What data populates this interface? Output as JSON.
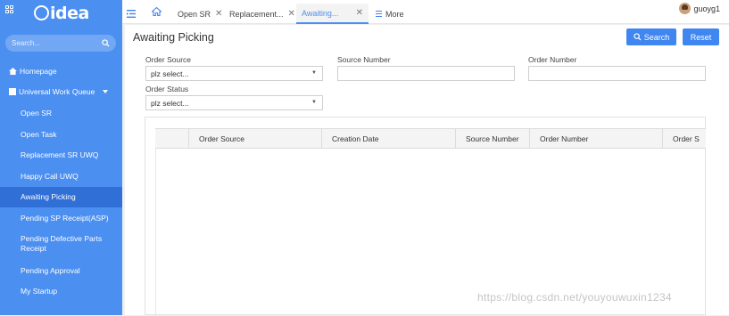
{
  "sidebar": {
    "logo_text": "idea",
    "search_placeholder": "Search...",
    "items": [
      {
        "label": "Homepage",
        "icon": "home-icon"
      },
      {
        "label": "Universal Work Queue",
        "icon": "square-icon"
      },
      {
        "label": "Open SR"
      },
      {
        "label": "Open Task"
      },
      {
        "label": "Replacement SR UWQ"
      },
      {
        "label": "Happy Call UWQ"
      },
      {
        "label": "Awaiting Picking",
        "active": true
      },
      {
        "label": "Pending SP Receipt(ASP)"
      },
      {
        "label": "Pending Defective Parts Receipt"
      },
      {
        "label": "Pending Approval"
      },
      {
        "label": "My Startup"
      }
    ]
  },
  "topbar": {
    "tabs": [
      {
        "label": "Open SR",
        "closable": true
      },
      {
        "label": "Replacement...",
        "closable": true
      },
      {
        "label": "Awaiting...",
        "closable": true,
        "active": true
      },
      {
        "label": "More",
        "icon": "list-icon"
      }
    ],
    "user": "guoyg1"
  },
  "main": {
    "title": "Awaiting Picking",
    "search_button": "Search",
    "reset_button": "Reset",
    "filters": {
      "order_source_label": "Order Source",
      "order_source_value": "plz select...",
      "source_number_label": "Source Number",
      "order_number_label": "Order Number",
      "order_status_label": "Order Status",
      "order_status_value": "plz select..."
    },
    "grid_columns": [
      "",
      "Order Source",
      "Creation Date",
      "Source Number",
      "Order Number",
      "Order S"
    ]
  },
  "watermark": "https://blog.csdn.net/youyouwuxin1234",
  "colors": {
    "sidebar": "#4b8ff0",
    "sidebar_active": "#2f6fd6",
    "button": "#3f86f0"
  }
}
